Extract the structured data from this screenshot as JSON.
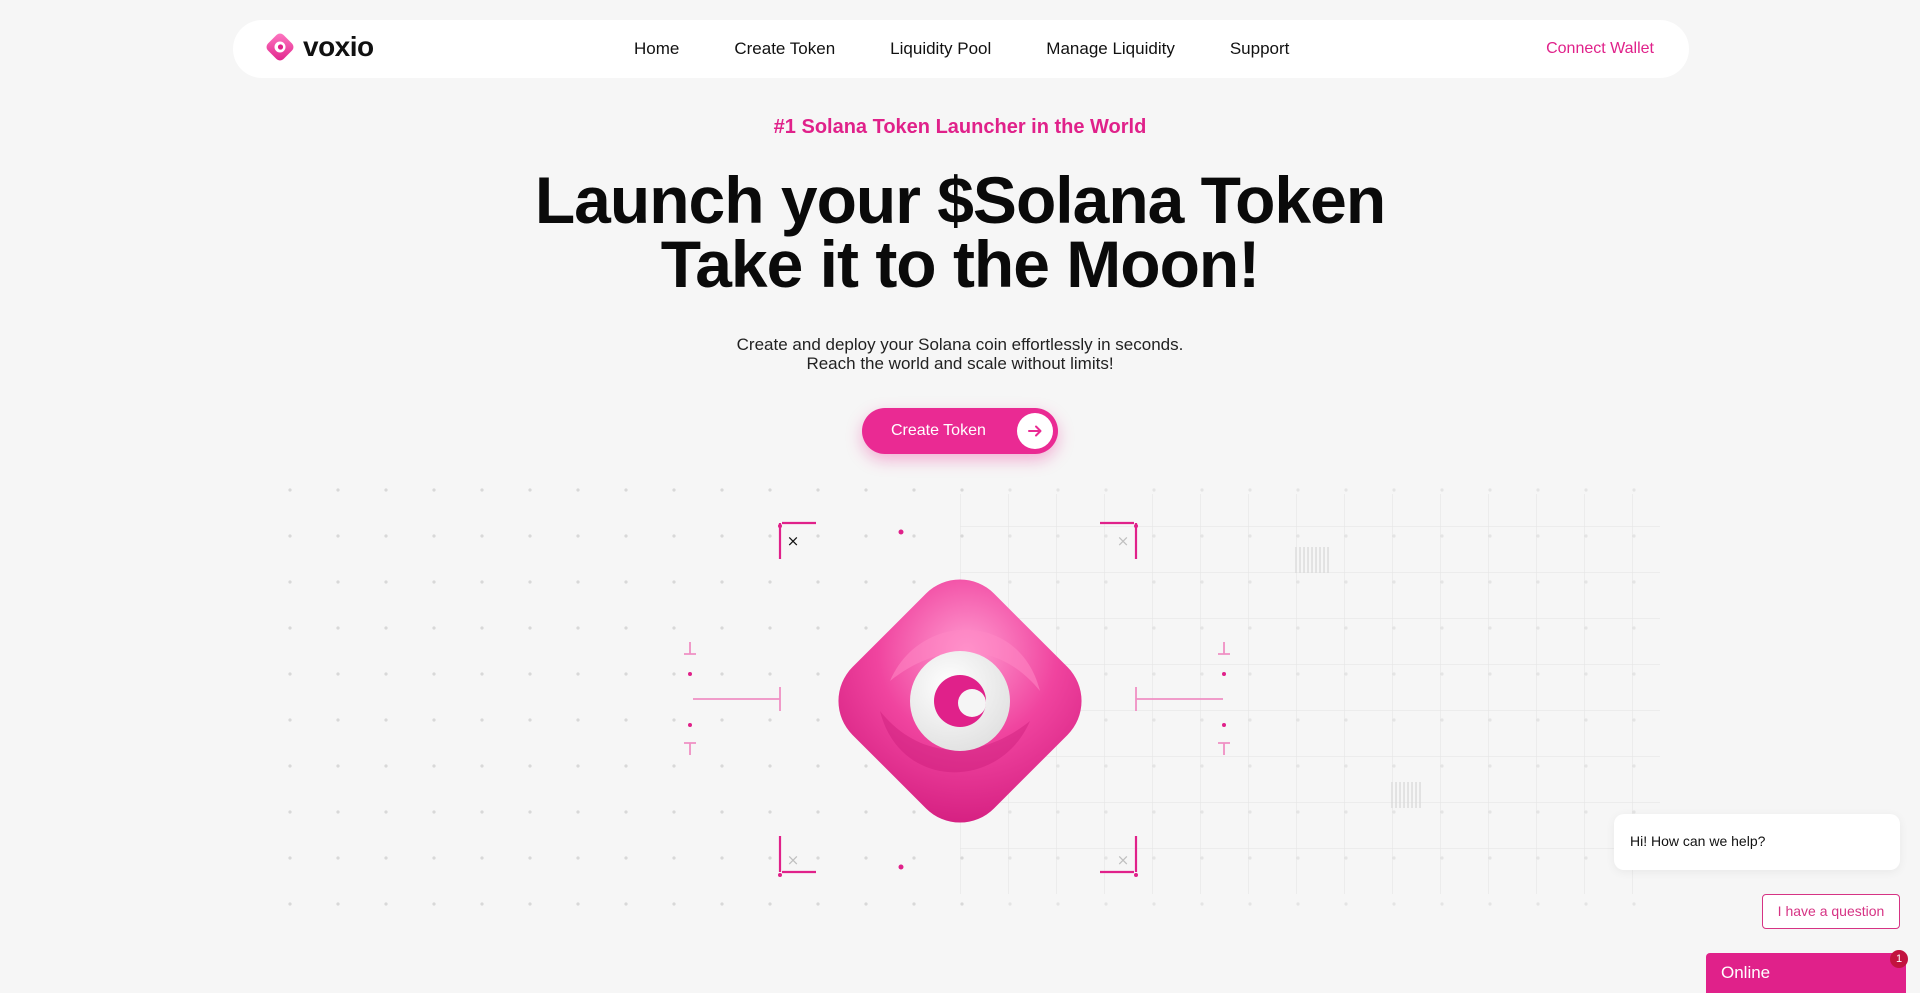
{
  "brand": {
    "name": "voxio",
    "icon": "diamond-logo-icon"
  },
  "nav": {
    "links": [
      "Home",
      "Create Token",
      "Liquidity Pool",
      "Manage Liquidity",
      "Support"
    ],
    "connect_label": "Connect Wallet"
  },
  "hero": {
    "eyebrow": "#1 Solana Token Launcher in the World",
    "headline_line1": "Launch your $Solana Token",
    "headline_line2": "Take it to the Moon!",
    "subtext_line1": "Create and deploy your Solana coin effortlessly in seconds.",
    "subtext_line2": "Reach the world and scale without limits!",
    "cta_label": "Create Token",
    "cta_icon": "arrow-right-icon"
  },
  "chat": {
    "greeting": "Hi! How can we help?",
    "question_label": "I have a question",
    "status": "Online",
    "unread_count": "1"
  },
  "colors": {
    "accent": "#e0218a",
    "background": "#f6f6f6"
  }
}
